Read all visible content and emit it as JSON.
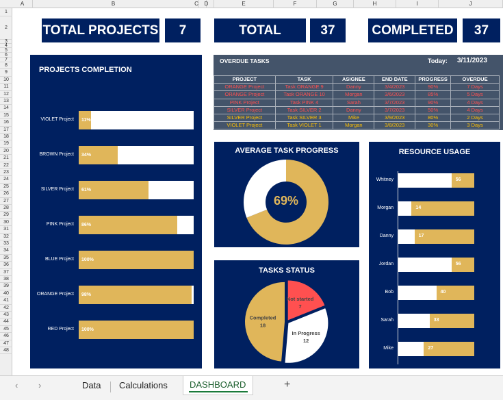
{
  "sheet": {
    "columns": [
      "A",
      "B",
      "C",
      "D",
      "E",
      "F",
      "G",
      "H",
      "I",
      "J"
    ],
    "row_count": 48
  },
  "kpis": [
    {
      "label": "TOTAL PROJECTS",
      "value": "7"
    },
    {
      "label": "TOTAL",
      "value": "37"
    },
    {
      "label": "COMPLETED",
      "value": "37"
    }
  ],
  "projects_completion": {
    "title": "PROJECTS COMPLETION",
    "items": [
      {
        "name": "VIOLET Project",
        "pct": 11,
        "label": "11%"
      },
      {
        "name": "BROWN Project",
        "pct": 34,
        "label": "34%"
      },
      {
        "name": "SILVER Project",
        "pct": 61,
        "label": "61%"
      },
      {
        "name": "PINK Project",
        "pct": 86,
        "label": "86%"
      },
      {
        "name": "BLUE Project",
        "pct": 100,
        "label": "100%"
      },
      {
        "name": "ORANGE Project",
        "pct": 98,
        "label": "98%"
      },
      {
        "name": "RED Project",
        "pct": 100,
        "label": "100%"
      }
    ]
  },
  "overdue": {
    "title": "OVERDUE TASKS",
    "today_label": "Today:",
    "today": "3/11/2023",
    "headers": [
      "PROJECT",
      "TASK",
      "ASIGNEE",
      "END DATE",
      "PROGRESS",
      "OVERDUE"
    ],
    "rows": [
      {
        "cells": [
          "ORANGE Project",
          "Task ORANGE 9",
          "Danny",
          "3/4/2023",
          "90%",
          "7 Days"
        ],
        "color": "#FF5050"
      },
      {
        "cells": [
          "ORANGE Project",
          "Task ORANGE 10",
          "Morgan",
          "3/6/2023",
          "85%",
          "5 Days"
        ],
        "color": "#FF5050"
      },
      {
        "cells": [
          "PINK Project",
          "Task PINK 4",
          "Sarah",
          "3/7/2023",
          "90%",
          "4 Days"
        ],
        "color": "#FF5050"
      },
      {
        "cells": [
          "SILVER Project",
          "Task SILVER 2",
          "Danny",
          "3/7/2023",
          "50%",
          "4 Days"
        ],
        "color": "#FF5050"
      },
      {
        "cells": [
          "SILVER Project",
          "Task SILVER 3",
          "Mike",
          "3/9/2023",
          "80%",
          "2 Days"
        ],
        "color": "#FFC000"
      },
      {
        "cells": [
          "VIOLET Project",
          "Task VIOLET 1",
          "Morgan",
          "3/8/2023",
          "30%",
          "3 Days"
        ],
        "color": "#FFC000"
      }
    ]
  },
  "avg_progress": {
    "title": "AVERAGE TASK PROGRESS",
    "value": 69,
    "label": "69%"
  },
  "chart_data": [
    {
      "type": "pie",
      "title": "TASKS STATUS",
      "categories": [
        "Not started",
        "In Progress",
        "Completed"
      ],
      "values": [
        7,
        12,
        18
      ],
      "colors": [
        "#FF5050",
        "#FFFFFF",
        "#E0B65A"
      ]
    },
    {
      "type": "bar",
      "title": "RESOURCE USAGE",
      "orientation": "horizontal",
      "categories": [
        "Whitney",
        "Morgan",
        "Danny",
        "Jordan",
        "Bob",
        "Sarah",
        "Mike"
      ],
      "values": [
        56,
        14,
        17,
        56,
        40,
        33,
        27
      ],
      "xlim": [
        0,
        80
      ]
    }
  ],
  "colors": {
    "navy": "#002060",
    "gold": "#E0B65A",
    "table_bg": "#44546A",
    "red": "#FF5050",
    "amber": "#FFC000"
  },
  "tabs": {
    "items": [
      "Data",
      "Calculations",
      "DASHBOARD"
    ],
    "active": "DASHBOARD",
    "add": "+",
    "prev": "‹",
    "next": "›"
  }
}
